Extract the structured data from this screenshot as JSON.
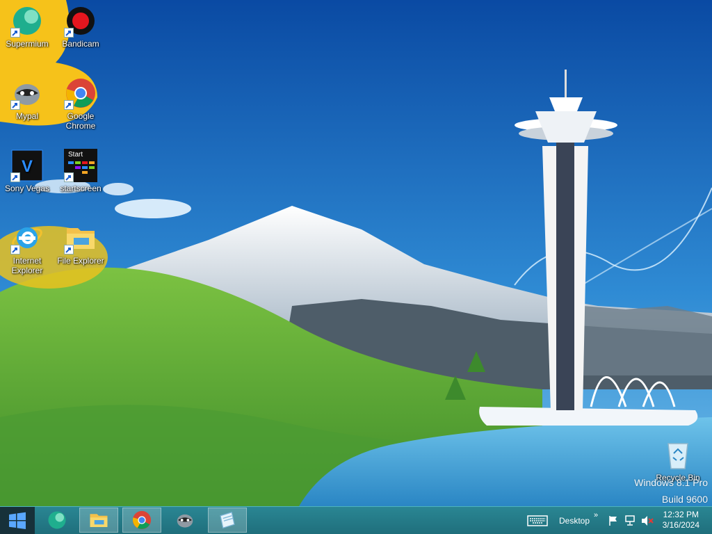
{
  "desktop": {
    "icons": [
      {
        "label": "Supermium",
        "icon": "supermium-icon"
      },
      {
        "label": "Bandicam",
        "icon": "bandicam-icon"
      },
      {
        "label": "Mypal",
        "icon": "mypal-icon"
      },
      {
        "label": "Google\nChrome",
        "icon": "chrome-icon"
      },
      {
        "label": "Sony Vegas",
        "icon": "sony-vegas-icon"
      },
      {
        "label": "startscreen",
        "icon": "startscreen-icon",
        "tile_text": "Start"
      },
      {
        "label": "Internet\nExplorer",
        "icon": "internet-explorer-icon"
      },
      {
        "label": "File Explorer",
        "icon": "file-explorer-icon"
      },
      {
        "label": "Recycle Bin",
        "icon": "recycle-bin-icon"
      }
    ],
    "watermark": {
      "line1": "Windows 8.1 Pro",
      "line2": "Build 9600"
    }
  },
  "taskbar": {
    "start_icon": "windows-logo-icon",
    "pinned": [
      {
        "name": "supermium-icon"
      },
      {
        "name": "file-explorer-icon"
      },
      {
        "name": "chrome-icon"
      },
      {
        "name": "mypal-icon"
      },
      {
        "name": "notepad-icon"
      }
    ],
    "tray": {
      "desktop_label": "Desktop",
      "chevron": "»",
      "icons": [
        "keyboard-icon",
        "flag-icon",
        "network-icon",
        "volume-muted-icon"
      ]
    },
    "clock": {
      "time": "12:32 PM",
      "date": "3/16/2024"
    }
  },
  "colors": {
    "sky_top": "#0b4ea6",
    "sky_bottom": "#5fb4e4",
    "grass": "#5aa83a",
    "taskbar": "#24808d",
    "accent_yellow": "#f6c21a"
  }
}
